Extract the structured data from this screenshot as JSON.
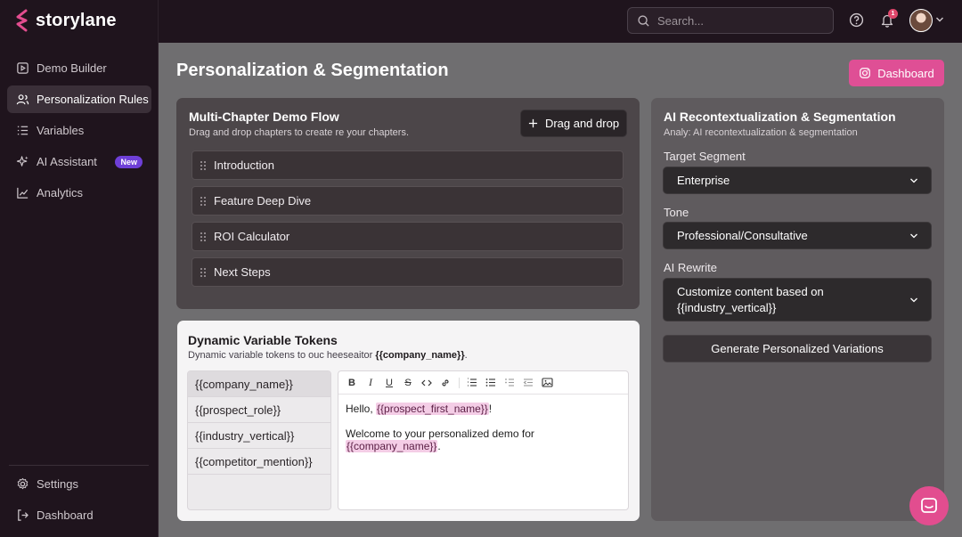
{
  "app": {
    "brand": "storylane",
    "brand_color": "#e24d8f"
  },
  "sidebar": {
    "items": [
      {
        "label": "Demo Builder",
        "icon": "play-square-icon",
        "active": false
      },
      {
        "label": "Personalization Rules",
        "icon": "users-icon",
        "active": true
      },
      {
        "label": "Variables",
        "icon": "list-icon",
        "active": false
      },
      {
        "label": "AI Assistant",
        "icon": "sparkle-icon",
        "active": false,
        "badge": "New"
      },
      {
        "label": "Analytics",
        "icon": "trend-chart-icon",
        "active": false
      }
    ],
    "bottom": [
      {
        "label": "Settings",
        "icon": "gear-icon"
      },
      {
        "label": "Dashboard",
        "icon": "logout-icon"
      }
    ]
  },
  "topbar": {
    "search_placeholder": "Search...",
    "notification_count": "1"
  },
  "page": {
    "title": "Personalization & Segmentation",
    "dashboard_button": "Dashboard"
  },
  "flow": {
    "title": "Multi-Chapter Demo Flow",
    "subtitle": "Drag and drop chapters to create re your chapters.",
    "button": "Drag and drop",
    "chapters": [
      "Introduction",
      "Feature Deep Dive",
      "ROI Calculator",
      "Next Steps"
    ]
  },
  "tokens": {
    "title": "Dynamic Variable Tokens",
    "subtitle_prefix": "Dynamic variable tokens to ouc heeseaitor ",
    "subtitle_token": "{{company_name}}",
    "subtitle_suffix": ".",
    "list": [
      "{{company_name}}",
      "{{prospect_role}}",
      "{{industry_vertical}}",
      "{{competitor_mention}}"
    ],
    "editor": {
      "line1_prefix": "Hello, ",
      "line1_token": "{{prospect_first_name}}",
      "line1_suffix": "!",
      "line2_prefix": "Welcome to your personalized demo for ",
      "line2_token": "{{company_name}}",
      "line2_suffix": "."
    }
  },
  "ai": {
    "title": "AI Recontextualization & Segmentation",
    "subtitle": "Analy: AI recontextualization & segmentation",
    "segment_label": "Target Segment",
    "segment_value": "Enterprise",
    "tone_label": "Tone",
    "tone_value": "Professional/Consultative",
    "rewrite_label": "AI Rewrite",
    "rewrite_value_1": "Customize content based on",
    "rewrite_value_2": "{{industry_vertical}}",
    "generate_button": "Generate Personalized Variations"
  }
}
